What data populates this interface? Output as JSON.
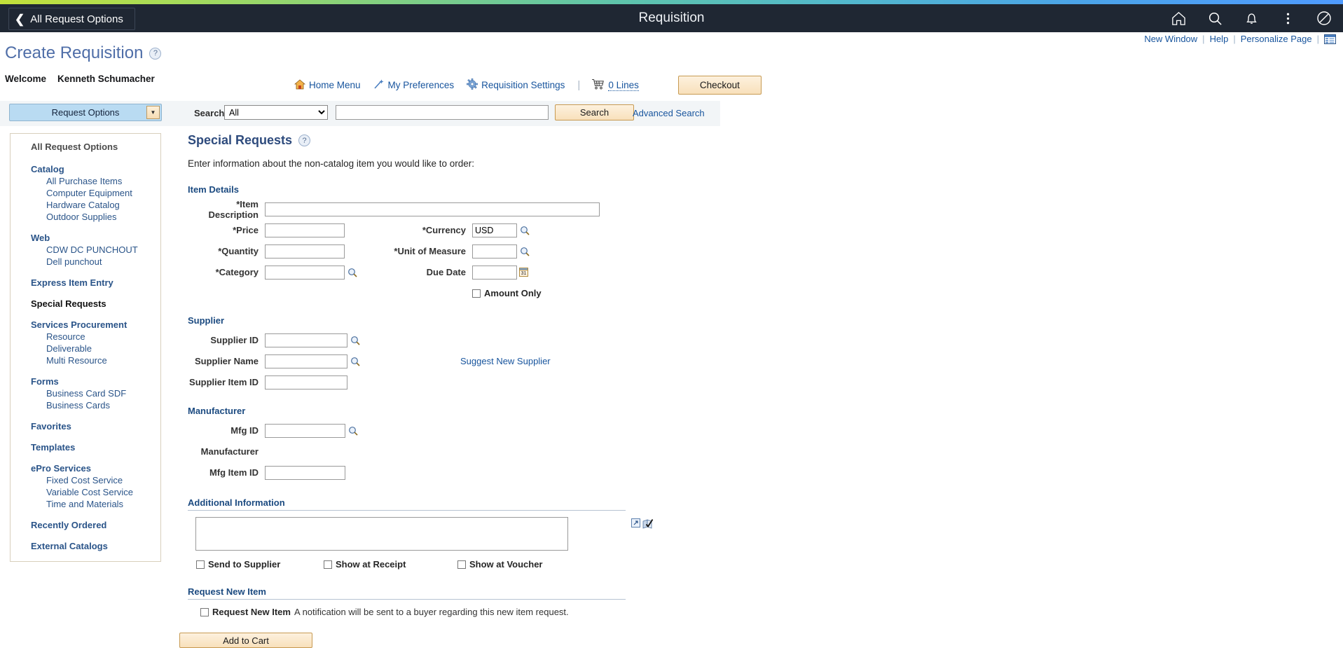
{
  "navbar": {
    "back_label": "All Request Options",
    "title": "Requisition",
    "icons": [
      {
        "name": "home-icon",
        "label": "Home"
      },
      {
        "name": "search-icon",
        "label": "Search"
      },
      {
        "name": "notifications-bell-icon",
        "label": "Notifications"
      },
      {
        "name": "actions-kebab-icon",
        "label": "Actions"
      },
      {
        "name": "nav-compass-icon",
        "label": "NavBar"
      }
    ],
    "gradient_colors": [
      "#c3e03a",
      "#7fcf85",
      "#53b9cb",
      "#4f9bff"
    ],
    "background": "#1f2733"
  },
  "linkbar": {
    "new_window": "New Window",
    "help": "Help",
    "personalize_page": "Personalize Page",
    "grid_icon": "page-layout-icon",
    "separator": "|"
  },
  "page": {
    "title": "Create Requisition",
    "help_glyph": "?",
    "title_color": "#4f6ea8"
  },
  "welcome": {
    "greeting": "Welcome",
    "user_name": "Kenneth Schumacher"
  },
  "toolbar": {
    "items": [
      {
        "icon": "home-menu-icon",
        "label": "Home Menu"
      },
      {
        "icon": "my-preferences-wand-icon",
        "label": "My Preferences"
      },
      {
        "icon": "requisition-settings-gear-icon",
        "label": "Requisition Settings"
      }
    ],
    "separator": "|",
    "cart_icon": "shopping-cart-icon",
    "cart_lines": "0 Lines",
    "checkout_label": "Checkout",
    "button_accent": "#c79a52"
  },
  "search": {
    "request_options_label": "Request Options",
    "request_options_caret": "▼",
    "label": "Search",
    "selected_category": "All",
    "category_options": [
      "All"
    ],
    "query_value": "",
    "query_placeholder": "",
    "button_label": "Search",
    "advanced_label": "Advanced Search"
  },
  "sidebar": {
    "heading": "All Request Options",
    "groups": [
      {
        "label": "Catalog",
        "state": "link",
        "children": [
          "All Purchase Items",
          "Computer Equipment",
          "Hardware Catalog",
          "Outdoor Supplies"
        ]
      },
      {
        "label": "Web",
        "state": "link",
        "children": [
          "CDW DC PUNCHOUT",
          "Dell punchout"
        ]
      },
      {
        "label": "Express Item Entry",
        "state": "link",
        "children": []
      },
      {
        "label": "Special Requests",
        "state": "current",
        "children": []
      },
      {
        "label": "Services Procurement",
        "state": "link",
        "children": [
          "Resource",
          "Deliverable",
          "Multi Resource"
        ]
      },
      {
        "label": "Forms",
        "state": "link",
        "children": [
          "Business Card SDF",
          "Business Cards"
        ]
      },
      {
        "label": "Favorites",
        "state": "link",
        "children": []
      },
      {
        "label": "Templates",
        "state": "link",
        "children": []
      },
      {
        "label": "ePro Services",
        "state": "link",
        "children": [
          "Fixed Cost Service",
          "Variable Cost Service",
          "Time and Materials"
        ]
      },
      {
        "label": "Recently Ordered",
        "state": "link",
        "children": []
      },
      {
        "label": "External Catalogs",
        "state": "link",
        "children": []
      }
    ]
  },
  "form": {
    "heading": "Special Requests",
    "heading_help": "?",
    "description": "Enter information about the non-catalog item you would like to order:",
    "item_details": {
      "title": "Item Details",
      "item_description_label": "*Item Description",
      "item_description_value": "",
      "price_label": "*Price",
      "price_value": "",
      "quantity_label": "*Quantity",
      "quantity_value": "",
      "category_label": "*Category",
      "category_value": "",
      "currency_label": "*Currency",
      "currency_value": "USD",
      "uom_label": "*Unit of Measure",
      "uom_value": "",
      "due_date_label": "Due Date",
      "due_date_value": "",
      "amount_only_label": "Amount Only",
      "amount_only_checked": false
    },
    "supplier": {
      "title": "Supplier",
      "supplier_id_label": "Supplier ID",
      "supplier_id_value": "",
      "supplier_name_label": "Supplier Name",
      "supplier_name_value": "",
      "supplier_item_id_label": "Supplier Item ID",
      "supplier_item_id_value": "",
      "suggest_link": "Suggest New Supplier"
    },
    "manufacturer": {
      "title": "Manufacturer",
      "mfg_id_label": "Mfg ID",
      "mfg_id_value": "",
      "manufacturer_label": "Manufacturer",
      "manufacturer_value": "",
      "mfg_item_id_label": "Mfg Item ID",
      "mfg_item_id_value": ""
    },
    "additional_information": {
      "title": "Additional Information",
      "text_value": "",
      "expand_icon": "expand-textarea-icon",
      "spellcheck_icon": "spell-check-icon",
      "checkboxes": [
        {
          "label": "Send to Supplier",
          "checked": false
        },
        {
          "label": "Show at Receipt",
          "checked": false
        },
        {
          "label": "Show at Voucher",
          "checked": false
        }
      ]
    },
    "request_new_item": {
      "title": "Request New Item",
      "checkbox_label": "Request New Item",
      "checked": false,
      "note": "A notification will be sent to a buyer regarding this new item request."
    },
    "add_to_cart_label": "Add to Cart"
  }
}
